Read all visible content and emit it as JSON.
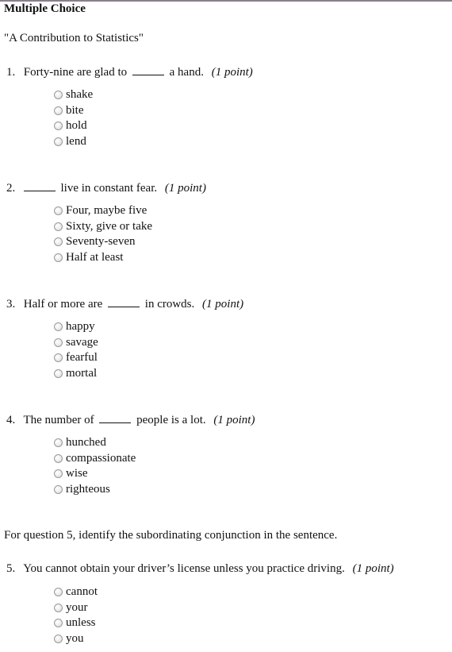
{
  "page": {
    "title": "Multiple Choice",
    "subtitle": "\"A Contribution to Statistics\""
  },
  "instruction": "For question 5, identify the subordinating conjunction in the sentence.",
  "questions": [
    {
      "number": "1.",
      "before": "Forty-nine are glad to",
      "after": "a hand.",
      "points": "(1 point)",
      "options": [
        "shake",
        "bite",
        "hold",
        "lend"
      ]
    },
    {
      "number": "2.",
      "before": "",
      "after": "live in constant fear.",
      "points": "(1 point)",
      "options": [
        "Four, maybe five",
        "Sixty, give or take",
        "Seventy-seven",
        "Half at least"
      ]
    },
    {
      "number": "3.",
      "before": "Half or more are",
      "after": "in crowds.",
      "points": "(1 point)",
      "options": [
        "happy",
        "savage",
        "fearful",
        "mortal"
      ]
    },
    {
      "number": "4.",
      "before": "The number of",
      "after": "people is a lot.",
      "points": "(1 point)",
      "options": [
        "hunched",
        "compassionate",
        "wise",
        "righteous"
      ]
    },
    {
      "number": "5.",
      "text": "You cannot obtain your driver’s license unless you practice driving.",
      "points": "(1 point)",
      "options": [
        "cannot",
        "your",
        "unless",
        "you"
      ]
    }
  ]
}
